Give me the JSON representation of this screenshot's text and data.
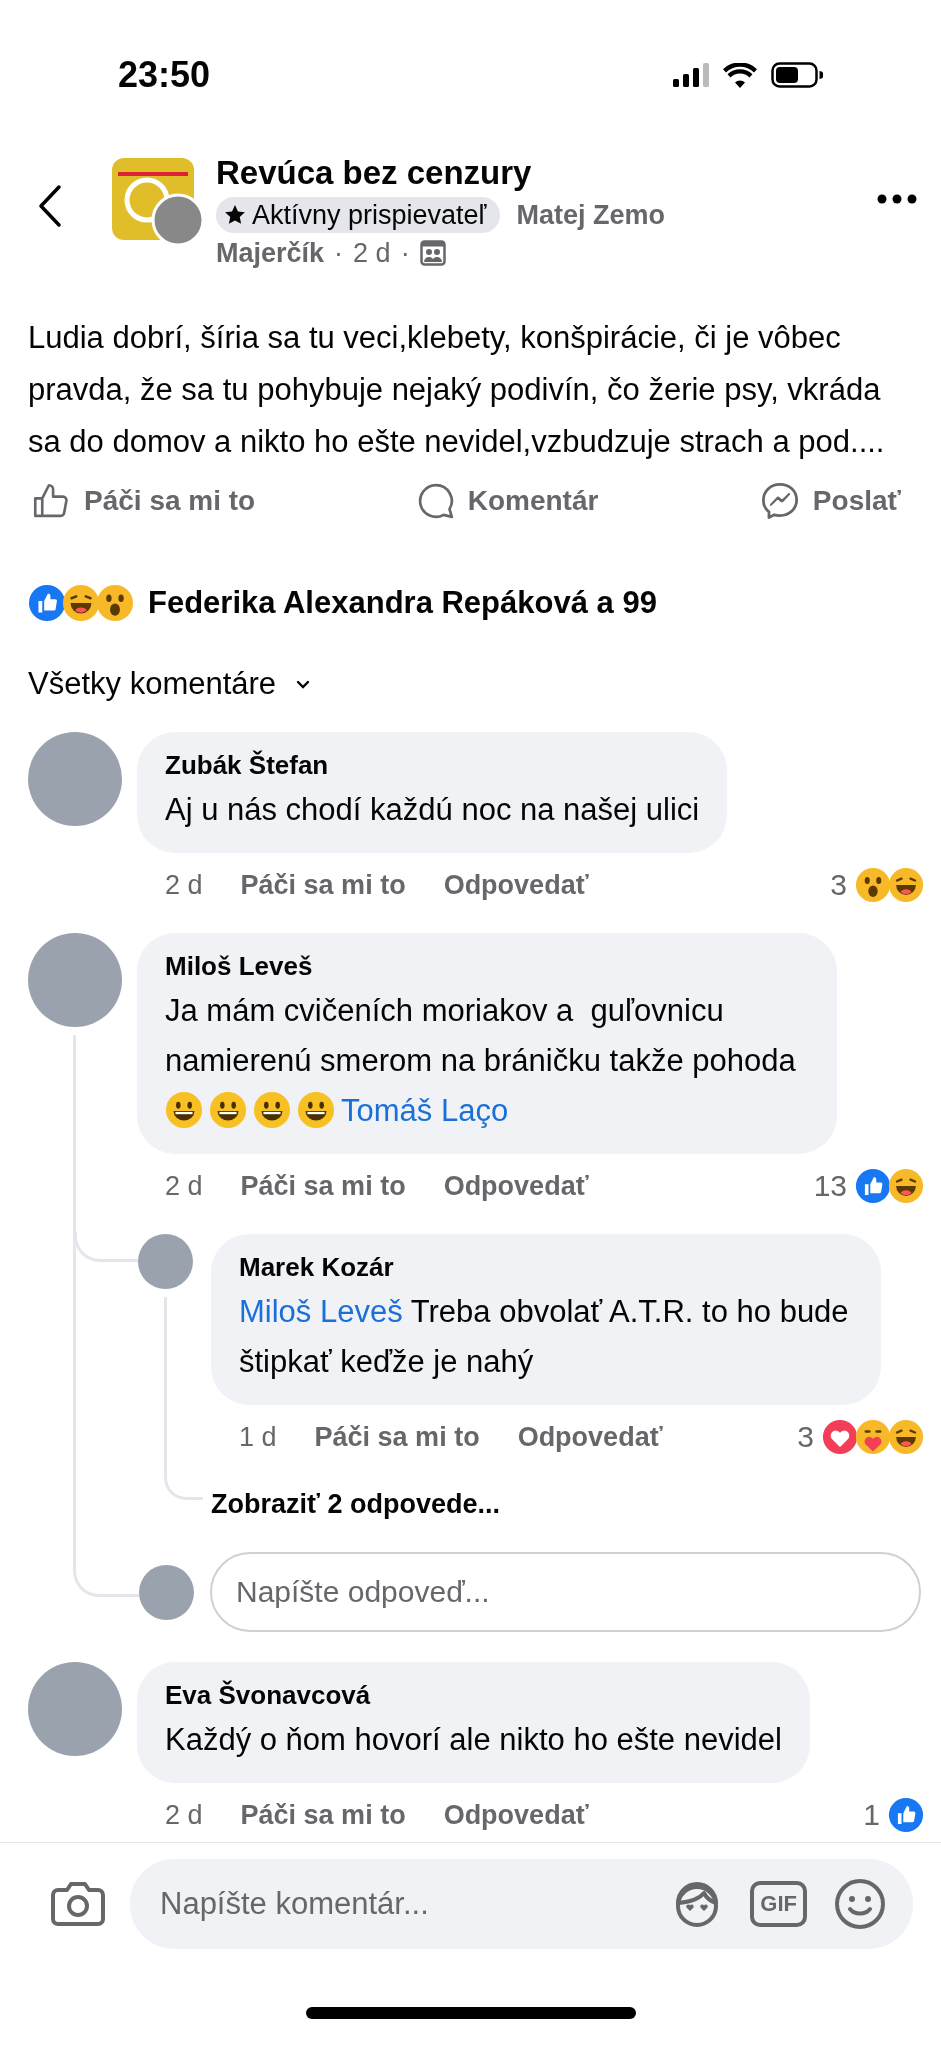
{
  "status_bar": {
    "time": "23:50"
  },
  "post": {
    "group": "Revúca bez cenzury",
    "badge": "Aktívny prispievateľ",
    "author_lines": [
      "Matej Zemo",
      "Majerčík"
    ],
    "separator": "·",
    "time": "2 d",
    "text": "Ludia dobrí, šíria sa tu veci,klebety, konšpirácie, či je vôbec pravda, že sa tu pohybuje nejaký podivín, čo žerie psy, vkráda sa do domov a nikto ho ešte nevidel,vzbudzuje strach a pod....",
    "actions": [
      {
        "kind": "like",
        "label": "Páči sa mi to"
      },
      {
        "kind": "comment",
        "label": "Komentár"
      },
      {
        "kind": "send",
        "label": "Poslať"
      }
    ],
    "reactions": [
      {
        "kind": "like"
      },
      {
        "kind": "haha"
      },
      {
        "kind": "wow"
      }
    ],
    "reactions_text": "Federika Alexandra Repáková a 99"
  },
  "sort": "Všetky komentáre",
  "comments": [
    {
      "author": "Zubák Štefan",
      "segments": [
        {
          "kind": "text",
          "text": "Aj u nás chodí každú noc na našej ulici"
        }
      ],
      "time": "2 d",
      "like": "Páči sa mi to",
      "reply": "Odpovedať",
      "reaction_count": "3",
      "reactions": [
        {
          "kind": "wow"
        },
        {
          "kind": "haha"
        }
      ]
    },
    {
      "author": "Miloš Leveš",
      "segments": [
        {
          "kind": "text",
          "text": "Ja mám cvičeních moriakov a  guľovnicu namierenú smerom na bráničku takže pohoda "
        },
        {
          "kind": "emoji"
        },
        {
          "kind": "emoji"
        },
        {
          "kind": "emoji"
        },
        {
          "kind": "emoji"
        },
        {
          "kind": "mention",
          "text": "Tomáš Laço"
        }
      ],
      "time": "2 d",
      "like": "Páči sa mi to",
      "reply": "Odpovedať",
      "reaction_count": "13",
      "reactions": [
        {
          "kind": "like"
        },
        {
          "kind": "haha"
        }
      ],
      "replies": [
        {
          "author": "Marek Kozár",
          "segments": [
            {
              "kind": "mention",
              "text": "Miloš Leveš"
            },
            {
              "kind": "text",
              "text": " Treba obvolať A.T.R. to ho bude štipkať keďže je nahý"
            }
          ],
          "time": "1 d",
          "like": "Páči sa mi to",
          "reply": "Odpovedať",
          "reaction_count": "3",
          "reactions": [
            {
              "kind": "love"
            },
            {
              "kind": "care"
            },
            {
              "kind": "haha"
            }
          ],
          "more_replies": "Zobraziť 2 odpovede..."
        }
      ],
      "reply_placeholder": "Napíšte odpoveď..."
    },
    {
      "author": "Eva Švonavcová",
      "segments": [
        {
          "kind": "text",
          "text": "Každý o ňom hovorí ale nikto ho ešte nevidel"
        }
      ],
      "time": "2 d",
      "like": "Páči sa mi to",
      "reply": "Odpovedať",
      "reaction_count": "1",
      "reactions": [
        {
          "kind": "like"
        }
      ]
    }
  ],
  "composer": {
    "placeholder": "Napíšte komentár...",
    "gif_label": "GIF"
  }
}
